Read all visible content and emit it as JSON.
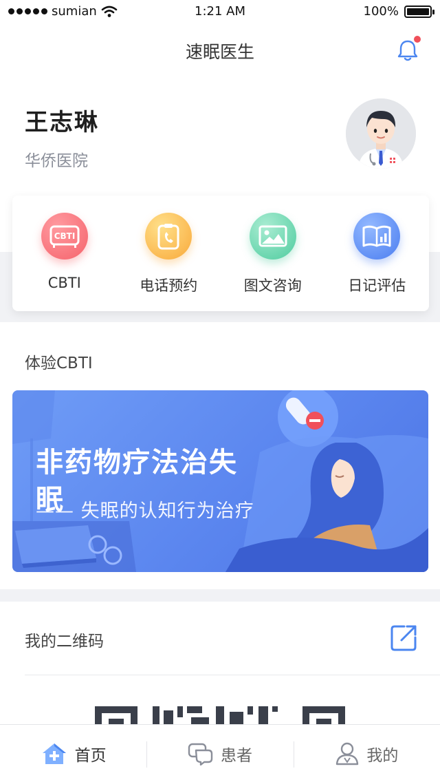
{
  "status_bar": {
    "carrier": "sumian",
    "time": "1:21 AM",
    "battery": "100%",
    "battery_level": 1.0
  },
  "nav": {
    "title": "速眠医生",
    "icon": "bell-icon",
    "has_notification": true
  },
  "profile": {
    "name": "王志琳",
    "hospital": "华侨医院",
    "avatar": "doctor-avatar"
  },
  "shortcuts": [
    {
      "label": "CBTI",
      "icon": "cbti-icon",
      "color": "#f5636b",
      "icon_text": "CBTI"
    },
    {
      "label": "电话预约",
      "icon": "phone-clipboard-icon",
      "color": "#f9a93a"
    },
    {
      "label": "图文咨询",
      "icon": "image-icon",
      "color": "#4fcc9f"
    },
    {
      "label": "日记评估",
      "icon": "diary-chart-icon",
      "color": "#4b7df0"
    }
  ],
  "cbti_section": {
    "title": "体验CBTI",
    "banner": {
      "headline": "非药物疗法治失眠",
      "subtitle": "—— 失眠的认知行为治疗"
    }
  },
  "qr_section": {
    "title": "我的二维码",
    "share_icon": "share-icon"
  },
  "tabs": [
    {
      "label": "首页",
      "icon": "home-plus-icon",
      "active": true
    },
    {
      "label": "患者",
      "icon": "chat-bubbles-icon",
      "active": false
    },
    {
      "label": "我的",
      "icon": "person-icon",
      "active": false
    }
  ],
  "colors": {
    "accent": "#4b86f0",
    "notification_dot": "#f0505a",
    "banner": "#5b86ef"
  }
}
